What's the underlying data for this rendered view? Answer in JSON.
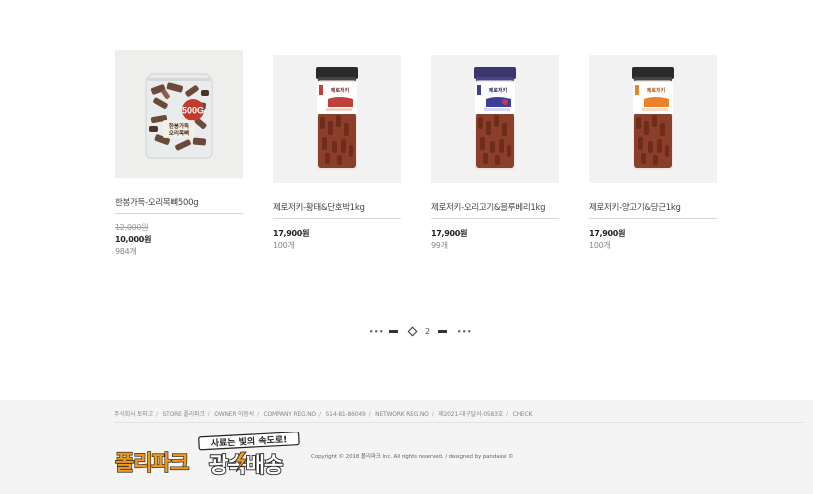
{
  "products": [
    {
      "name": "한봉가득-오리목뼈500g",
      "price_old": "12,000원",
      "price": "10,000원",
      "stock": "984개",
      "image_icon": "duck-neck-bag-icon",
      "bag_badge": "500G",
      "bag_text": "한봉가득 오리목뼈"
    },
    {
      "name": "제로저키-황태&단호박1kg",
      "price": "17,900원",
      "stock": "100개",
      "image_icon": "jerky-jar-icon",
      "jar_lid_color": "#2a2a2a",
      "accent_color": "#c0413a"
    },
    {
      "name": "제로저키-오리고기&블루베리1kg",
      "price": "17,900원",
      "stock": "99개",
      "image_icon": "jerky-jar-icon",
      "jar_lid_color": "#3b3570",
      "accent_color": "#3c3f9a"
    },
    {
      "name": "제로저키-양고기&당근1kg",
      "price": "17,900원",
      "stock": "100개",
      "image_icon": "jerky-jar-icon",
      "jar_lid_color": "#2a2a2a",
      "accent_color": "#e8832b"
    }
  ],
  "jar_label": "제로저키",
  "pagination": {
    "current": "2"
  },
  "footer": {
    "info": [
      "주식회사 토파고",
      "STORE 폴리파크",
      "OWNER 이동석",
      "COMPANY REG.NO",
      "514-81-86049",
      "NETWORK REG.NO",
      "제2021-대구달서-0583호",
      "CHECK"
    ],
    "copyright": "Copyright © 2018 폴리파크 Inc. All rights reserved. / designed by pandassi ©",
    "logo_top": "사료는 빛의 속도로!",
    "logo_main_left": "폴리파크",
    "logo_main_right": "광속배송",
    "brand_orange": "#f39a1a"
  }
}
